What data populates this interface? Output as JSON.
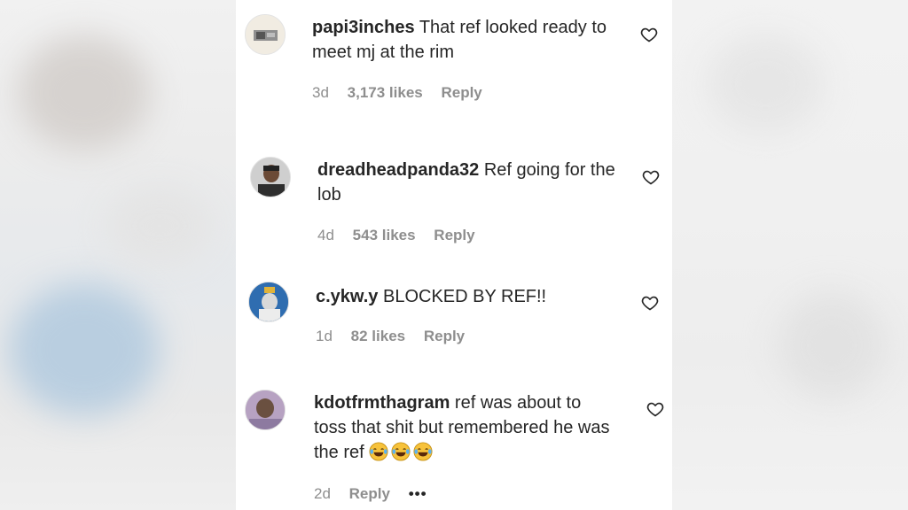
{
  "comments": [
    {
      "username": "papi3inches",
      "text": "That ref looked ready to meet mj at the rim",
      "time": "3d",
      "likes": "3,173 likes",
      "reply": "Reply"
    },
    {
      "username": "dreadheadpanda32",
      "text": "Ref going for the lob",
      "time": "4d",
      "likes": "543 likes",
      "reply": "Reply"
    },
    {
      "username": "c.ykw.y",
      "text": "BLOCKED BY REF!!",
      "time": "1d",
      "likes": "82 likes",
      "reply": "Reply"
    },
    {
      "username": "kdotfrmthagram",
      "text": "ref was about to toss that shit but remembered he was the ref",
      "emoji": "😂😂😂",
      "time": "2d",
      "reply": "Reply",
      "more": "•••"
    }
  ],
  "icons": {
    "like": "heart-outline-icon",
    "laugh": "face-with-tears-of-joy-icon"
  },
  "colors": {
    "text": "#262626",
    "meta": "#8e8e8e",
    "panel_bg": "#ffffff"
  }
}
